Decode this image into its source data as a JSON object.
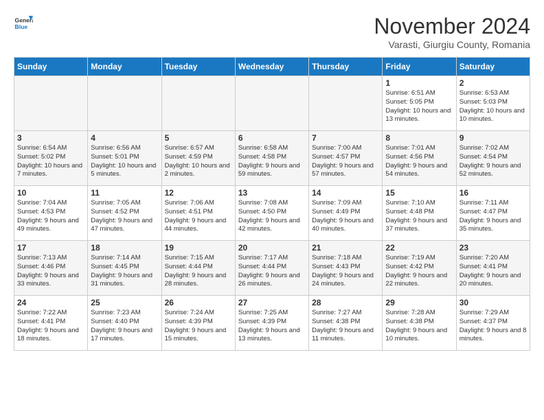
{
  "header": {
    "logo_line1": "General",
    "logo_line2": "Blue",
    "month": "November 2024",
    "location": "Varasti, Giurgiu County, Romania"
  },
  "weekdays": [
    "Sunday",
    "Monday",
    "Tuesday",
    "Wednesday",
    "Thursday",
    "Friday",
    "Saturday"
  ],
  "weeks": [
    [
      {
        "day": "",
        "info": ""
      },
      {
        "day": "",
        "info": ""
      },
      {
        "day": "",
        "info": ""
      },
      {
        "day": "",
        "info": ""
      },
      {
        "day": "",
        "info": ""
      },
      {
        "day": "1",
        "info": "Sunrise: 6:51 AM\nSunset: 5:05 PM\nDaylight: 10 hours and 13 minutes."
      },
      {
        "day": "2",
        "info": "Sunrise: 6:53 AM\nSunset: 5:03 PM\nDaylight: 10 hours and 10 minutes."
      }
    ],
    [
      {
        "day": "3",
        "info": "Sunrise: 6:54 AM\nSunset: 5:02 PM\nDaylight: 10 hours and 7 minutes."
      },
      {
        "day": "4",
        "info": "Sunrise: 6:56 AM\nSunset: 5:01 PM\nDaylight: 10 hours and 5 minutes."
      },
      {
        "day": "5",
        "info": "Sunrise: 6:57 AM\nSunset: 4:59 PM\nDaylight: 10 hours and 2 minutes."
      },
      {
        "day": "6",
        "info": "Sunrise: 6:58 AM\nSunset: 4:58 PM\nDaylight: 9 hours and 59 minutes."
      },
      {
        "day": "7",
        "info": "Sunrise: 7:00 AM\nSunset: 4:57 PM\nDaylight: 9 hours and 57 minutes."
      },
      {
        "day": "8",
        "info": "Sunrise: 7:01 AM\nSunset: 4:56 PM\nDaylight: 9 hours and 54 minutes."
      },
      {
        "day": "9",
        "info": "Sunrise: 7:02 AM\nSunset: 4:54 PM\nDaylight: 9 hours and 52 minutes."
      }
    ],
    [
      {
        "day": "10",
        "info": "Sunrise: 7:04 AM\nSunset: 4:53 PM\nDaylight: 9 hours and 49 minutes."
      },
      {
        "day": "11",
        "info": "Sunrise: 7:05 AM\nSunset: 4:52 PM\nDaylight: 9 hours and 47 minutes."
      },
      {
        "day": "12",
        "info": "Sunrise: 7:06 AM\nSunset: 4:51 PM\nDaylight: 9 hours and 44 minutes."
      },
      {
        "day": "13",
        "info": "Sunrise: 7:08 AM\nSunset: 4:50 PM\nDaylight: 9 hours and 42 minutes."
      },
      {
        "day": "14",
        "info": "Sunrise: 7:09 AM\nSunset: 4:49 PM\nDaylight: 9 hours and 40 minutes."
      },
      {
        "day": "15",
        "info": "Sunrise: 7:10 AM\nSunset: 4:48 PM\nDaylight: 9 hours and 37 minutes."
      },
      {
        "day": "16",
        "info": "Sunrise: 7:11 AM\nSunset: 4:47 PM\nDaylight: 9 hours and 35 minutes."
      }
    ],
    [
      {
        "day": "17",
        "info": "Sunrise: 7:13 AM\nSunset: 4:46 PM\nDaylight: 9 hours and 33 minutes."
      },
      {
        "day": "18",
        "info": "Sunrise: 7:14 AM\nSunset: 4:45 PM\nDaylight: 9 hours and 31 minutes."
      },
      {
        "day": "19",
        "info": "Sunrise: 7:15 AM\nSunset: 4:44 PM\nDaylight: 9 hours and 28 minutes."
      },
      {
        "day": "20",
        "info": "Sunrise: 7:17 AM\nSunset: 4:44 PM\nDaylight: 9 hours and 26 minutes."
      },
      {
        "day": "21",
        "info": "Sunrise: 7:18 AM\nSunset: 4:43 PM\nDaylight: 9 hours and 24 minutes."
      },
      {
        "day": "22",
        "info": "Sunrise: 7:19 AM\nSunset: 4:42 PM\nDaylight: 9 hours and 22 minutes."
      },
      {
        "day": "23",
        "info": "Sunrise: 7:20 AM\nSunset: 4:41 PM\nDaylight: 9 hours and 20 minutes."
      }
    ],
    [
      {
        "day": "24",
        "info": "Sunrise: 7:22 AM\nSunset: 4:41 PM\nDaylight: 9 hours and 18 minutes."
      },
      {
        "day": "25",
        "info": "Sunrise: 7:23 AM\nSunset: 4:40 PM\nDaylight: 9 hours and 17 minutes."
      },
      {
        "day": "26",
        "info": "Sunrise: 7:24 AM\nSunset: 4:39 PM\nDaylight: 9 hours and 15 minutes."
      },
      {
        "day": "27",
        "info": "Sunrise: 7:25 AM\nSunset: 4:39 PM\nDaylight: 9 hours and 13 minutes."
      },
      {
        "day": "28",
        "info": "Sunrise: 7:27 AM\nSunset: 4:38 PM\nDaylight: 9 hours and 11 minutes."
      },
      {
        "day": "29",
        "info": "Sunrise: 7:28 AM\nSunset: 4:38 PM\nDaylight: 9 hours and 10 minutes."
      },
      {
        "day": "30",
        "info": "Sunrise: 7:29 AM\nSunset: 4:37 PM\nDaylight: 9 hours and 8 minutes."
      }
    ]
  ]
}
